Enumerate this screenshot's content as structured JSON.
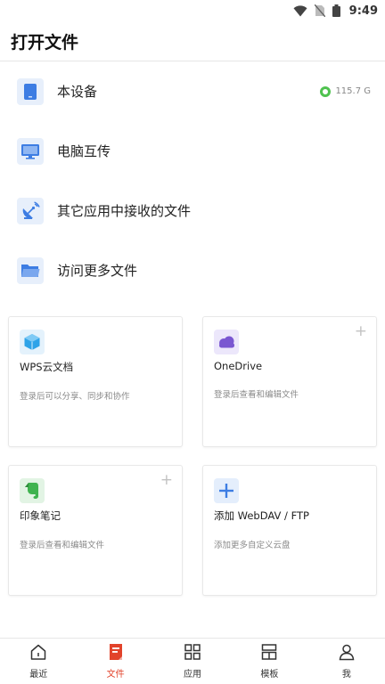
{
  "status_bar": {
    "time": "9:49",
    "icons": [
      "wifi-icon",
      "no-sim-icon",
      "battery-icon"
    ]
  },
  "header": {
    "title": "打开文件"
  },
  "locations": [
    {
      "label": "本设备",
      "icon": "tablet-icon",
      "storage": "115.7 G"
    },
    {
      "label": "电脑互传",
      "icon": "monitor-icon"
    },
    {
      "label": "其它应用中接收的文件",
      "icon": "satellite-dish-icon"
    },
    {
      "label": "访问更多文件",
      "icon": "folder-icon"
    }
  ],
  "cloud_cards": [
    {
      "title": "WPS云文档",
      "desc": "登录后可以分享、同步和协作",
      "icon": "wps-cloud-icon",
      "has_plus": false
    },
    {
      "title": "OneDrive",
      "desc": "登录后查看和编辑文件",
      "icon": "onedrive-icon",
      "has_plus": true
    },
    {
      "title": "印象笔记",
      "desc": "登录后查看和编辑文件",
      "icon": "evernote-icon",
      "has_plus": true
    },
    {
      "title": "添加 WebDAV / FTP",
      "desc": "添加更多自定义云盘",
      "icon": "add-plus-icon",
      "has_plus": false
    }
  ],
  "bottom_nav": {
    "items": [
      {
        "label": "最近",
        "icon": "home-icon",
        "active": false
      },
      {
        "label": "文件",
        "icon": "file-icon",
        "active": true
      },
      {
        "label": "应用",
        "icon": "apps-grid-icon",
        "active": false
      },
      {
        "label": "模板",
        "icon": "template-icon",
        "active": false
      },
      {
        "label": "我",
        "icon": "person-icon",
        "active": false
      }
    ]
  },
  "colors": {
    "accent": "#e2432b",
    "icon_blue": "#3d7de3",
    "storage_ring": "#4fc24f",
    "onedrive_purple": "#7a57d1",
    "evernote_green": "#3fb34f"
  }
}
